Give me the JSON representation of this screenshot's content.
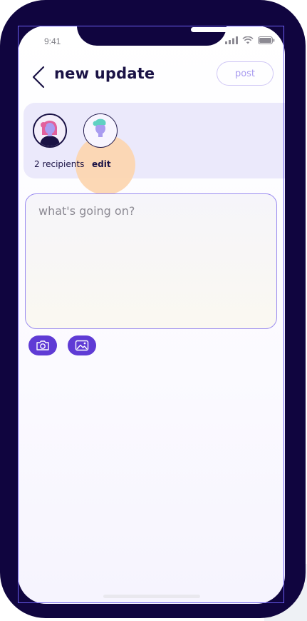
{
  "status_bar": {
    "time": "9:41"
  },
  "header": {
    "title": "new update",
    "post_label": "post"
  },
  "recipients": {
    "count_label": "2 recipients",
    "edit_label": "edit"
  },
  "compose": {
    "placeholder": "what's going on?"
  },
  "icons": {
    "back": "chevron-left-icon",
    "camera": "camera-icon",
    "image": "image-icon",
    "signal": "cellular-signal-icon",
    "wifi": "wifi-icon",
    "battery": "battery-icon"
  },
  "colors": {
    "phone_frame": "#10053f",
    "accent": "#5f3bd5",
    "highlight": "#fcd6b1",
    "card_bg": "#ebe9fb",
    "text_dark": "#1a1245"
  }
}
